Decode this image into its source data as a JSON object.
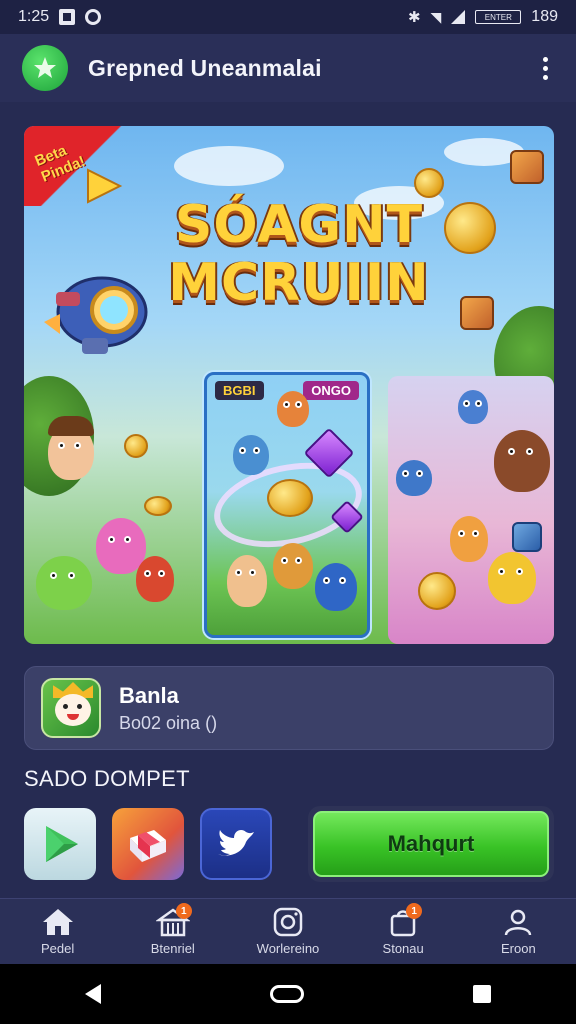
{
  "status_bar": {
    "time": "1:25",
    "battery_text": "ENTER",
    "clock_right": "189"
  },
  "header": {
    "title": "Grepned Uneanmalai",
    "logo_icon": "app-logo-icon",
    "menu_icon": "more-vert-icon"
  },
  "hero": {
    "ribbon_text": "Beta Pinda!",
    "title_line1": "SÓAGNT",
    "title_line2": "MCRUIIN",
    "card_label_left": "BGBI",
    "card_label_right": "ONGO"
  },
  "game": {
    "name": "Banla",
    "subtitle": "Bo02 oina ()"
  },
  "section": {
    "title": "SADO DOMPET"
  },
  "store_icons": [
    {
      "name": "play-store-icon"
    },
    {
      "name": "gift-icon"
    },
    {
      "name": "bird-icon"
    }
  ],
  "action": {
    "label": "Mahqurt"
  },
  "bottom_nav": {
    "items": [
      {
        "label": "Pedel",
        "icon": "home-icon",
        "badge": ""
      },
      {
        "label": "Btenriel",
        "icon": "store-icon",
        "badge": "1"
      },
      {
        "label": "Worlereino",
        "icon": "instagram-icon",
        "badge": ""
      },
      {
        "label": "Stonau",
        "icon": "bag-icon",
        "badge": "1"
      },
      {
        "label": "Eroon",
        "icon": "profile-icon",
        "badge": ""
      }
    ]
  },
  "colors": {
    "background": "#262b52",
    "header": "#2a2f58",
    "accent_green": "#39c326",
    "badge": "#f06a1e"
  }
}
